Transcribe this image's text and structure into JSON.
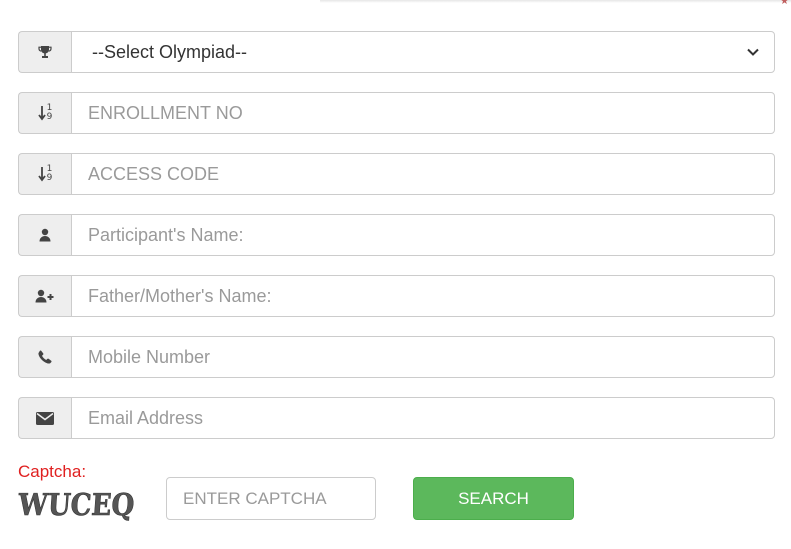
{
  "form": {
    "olympiad_select": {
      "selected": "--Select Olympiad--",
      "icon": "trophy-icon"
    },
    "fields": [
      {
        "placeholder": "ENROLLMENT NO",
        "icon": "sort-numeric-icon"
      },
      {
        "placeholder": "ACCESS CODE",
        "icon": "sort-numeric-icon"
      },
      {
        "placeholder": "Participant's Name:",
        "icon": "user-icon"
      },
      {
        "placeholder": "Father/Mother's Name:",
        "icon": "user-plus-icon"
      },
      {
        "placeholder": "Mobile Number",
        "icon": "phone-icon"
      },
      {
        "placeholder": "Email Address",
        "icon": "envelope-icon"
      }
    ]
  },
  "captcha": {
    "label": "Captcha:",
    "image_text": "WUCEQ",
    "input_placeholder": "ENTER CAPTCHA"
  },
  "search_button": {
    "label": "SEARCH"
  },
  "colors": {
    "captcha_label": "#e02020",
    "search_button": "#5cb85c",
    "addon_background": "#eeeeee",
    "border": "#cccccc"
  }
}
